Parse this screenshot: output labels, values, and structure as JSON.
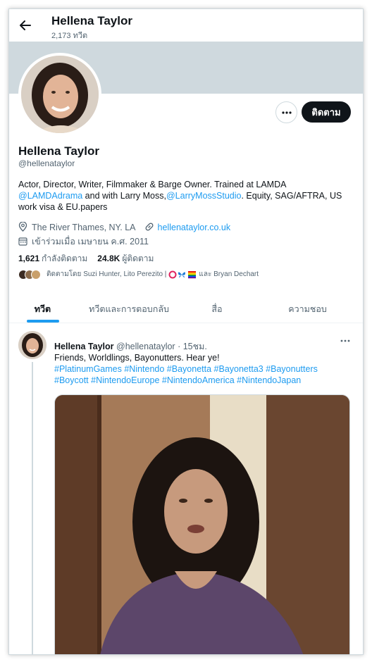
{
  "header": {
    "name": "Hellena Taylor",
    "tweet_count": "2,173 ทวีต"
  },
  "profile": {
    "display_name": "Hellena Taylor",
    "handle": "@hellenataylor",
    "follow_label": "ติดตาม",
    "bio": {
      "p1": "Actor, Director, Writer, Filmmaker & Barge Owner. Trained at LAMDA",
      "mention1": "@LAMDAdrama",
      "p2": " and with Larry Moss,",
      "mention2": "@LarryMossStudio",
      "p3": ". Equity, SAG/AFTRA, US work visa & EU.papers"
    },
    "location": "The River Thames, NY. LA",
    "website": "hellenataylor.co.uk",
    "joined": "เข้าร่วมเมื่อ เมษายน ค.ศ. 2011",
    "following_count": "1,621",
    "following_label": "กำลังติดตาม",
    "followers_count": "24.8K",
    "followers_label": "ผู้ติดตาม",
    "followed_by": {
      "prefix": "ติดตามโดย Suzi Hunter, Lito Perezito |",
      "suffix": "และ Bryan Dechart"
    }
  },
  "tabs": [
    {
      "label": "ทวีต"
    },
    {
      "label": "ทวีตและการตอบกลับ"
    },
    {
      "label": "สื่อ"
    },
    {
      "label": "ความชอบ"
    }
  ],
  "tweet": {
    "author": "Hellena Taylor",
    "handle": "@hellenataylor",
    "time": "· 15ชม.",
    "line1": "Friends, Worldlings, Bayonutters. Hear ye!",
    "hashtags1": "#PlatinumGames #Nintendo #Bayonetta #Bayonetta3 #Bayonutters",
    "hashtags2": "#Boycott #NintendoEurope #NintendoAmerica #NintendoJapan"
  },
  "colors": {
    "accent": "#1d9bf0",
    "banner": "#cfd9de",
    "button_dark": "#0f1419"
  }
}
